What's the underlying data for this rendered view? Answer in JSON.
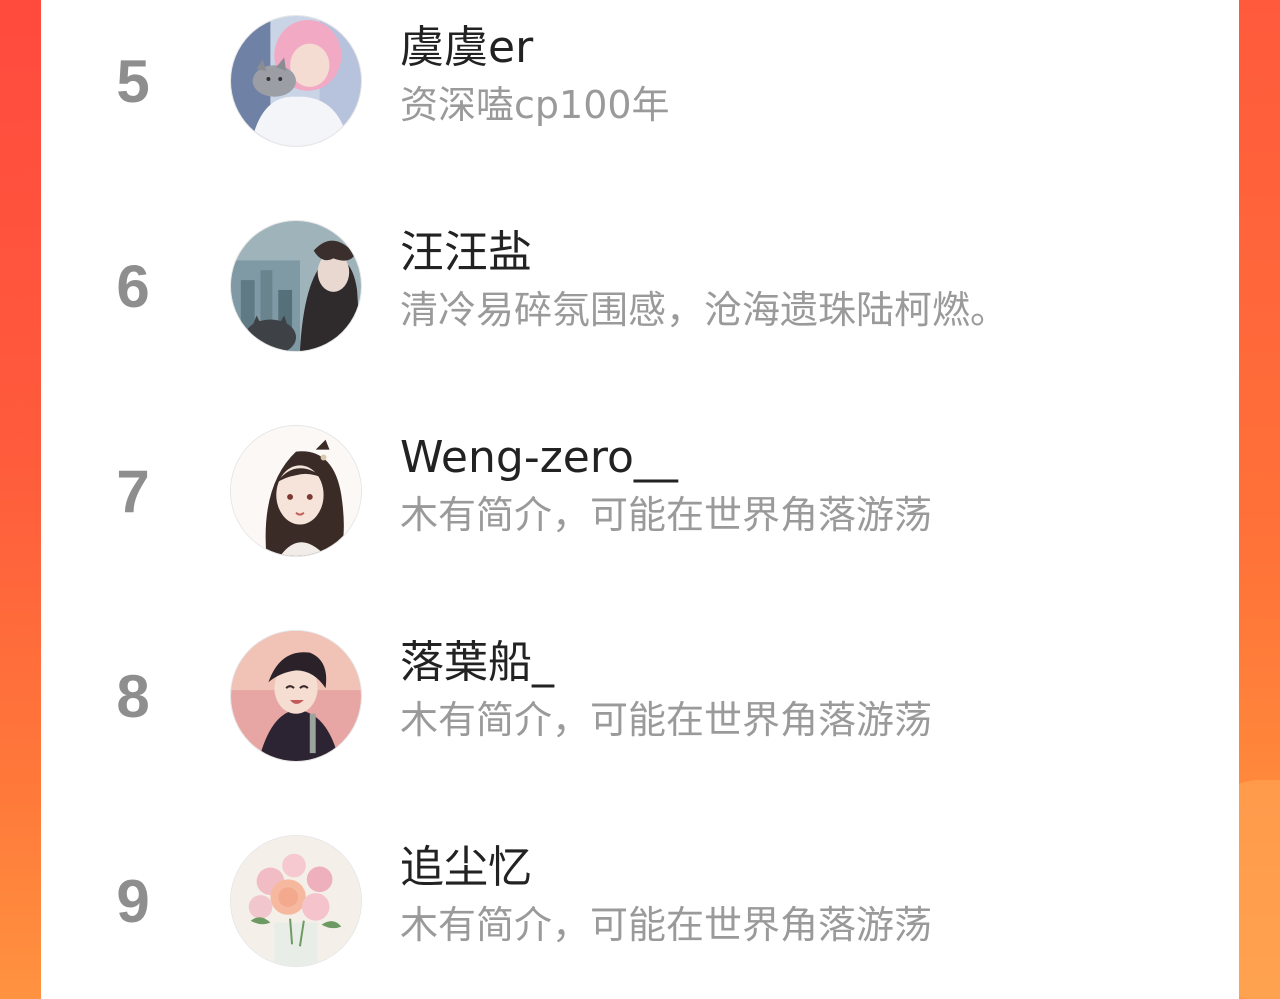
{
  "ranking": {
    "items": [
      {
        "rank": "5",
        "name": "虞虞er",
        "bio": "资深嗑cp100年",
        "avatar": "pink-hair-girl-with-cat-avatar"
      },
      {
        "rank": "6",
        "name": "汪汪盐",
        "bio": "清冷易碎氛围感，沧海遗珠陆柯燃。",
        "avatar": "rainy-window-boy-with-cat-avatar"
      },
      {
        "rank": "7",
        "name": "Weng-zero__",
        "bio": "木有简介，可能在世界角落游荡",
        "avatar": "ancient-style-girl-illustration-avatar"
      },
      {
        "rank": "8",
        "name": "落葉船_",
        "bio": "木有简介，可能在世界角落游荡",
        "avatar": "anime-boy-smiling-avatar"
      },
      {
        "rank": "9",
        "name": "追尘忆",
        "bio": "木有简介，可能在世界角落游荡",
        "avatar": "pink-roses-bouquet-avatar"
      }
    ]
  },
  "colors": {
    "background_gradient_top": "#ff4a3e",
    "background_gradient_bottom": "#ff9340",
    "rank_number": "#8e8e8e",
    "name_text": "#222222",
    "bio_text": "#9a9a9a",
    "panel": "#ffffff"
  }
}
